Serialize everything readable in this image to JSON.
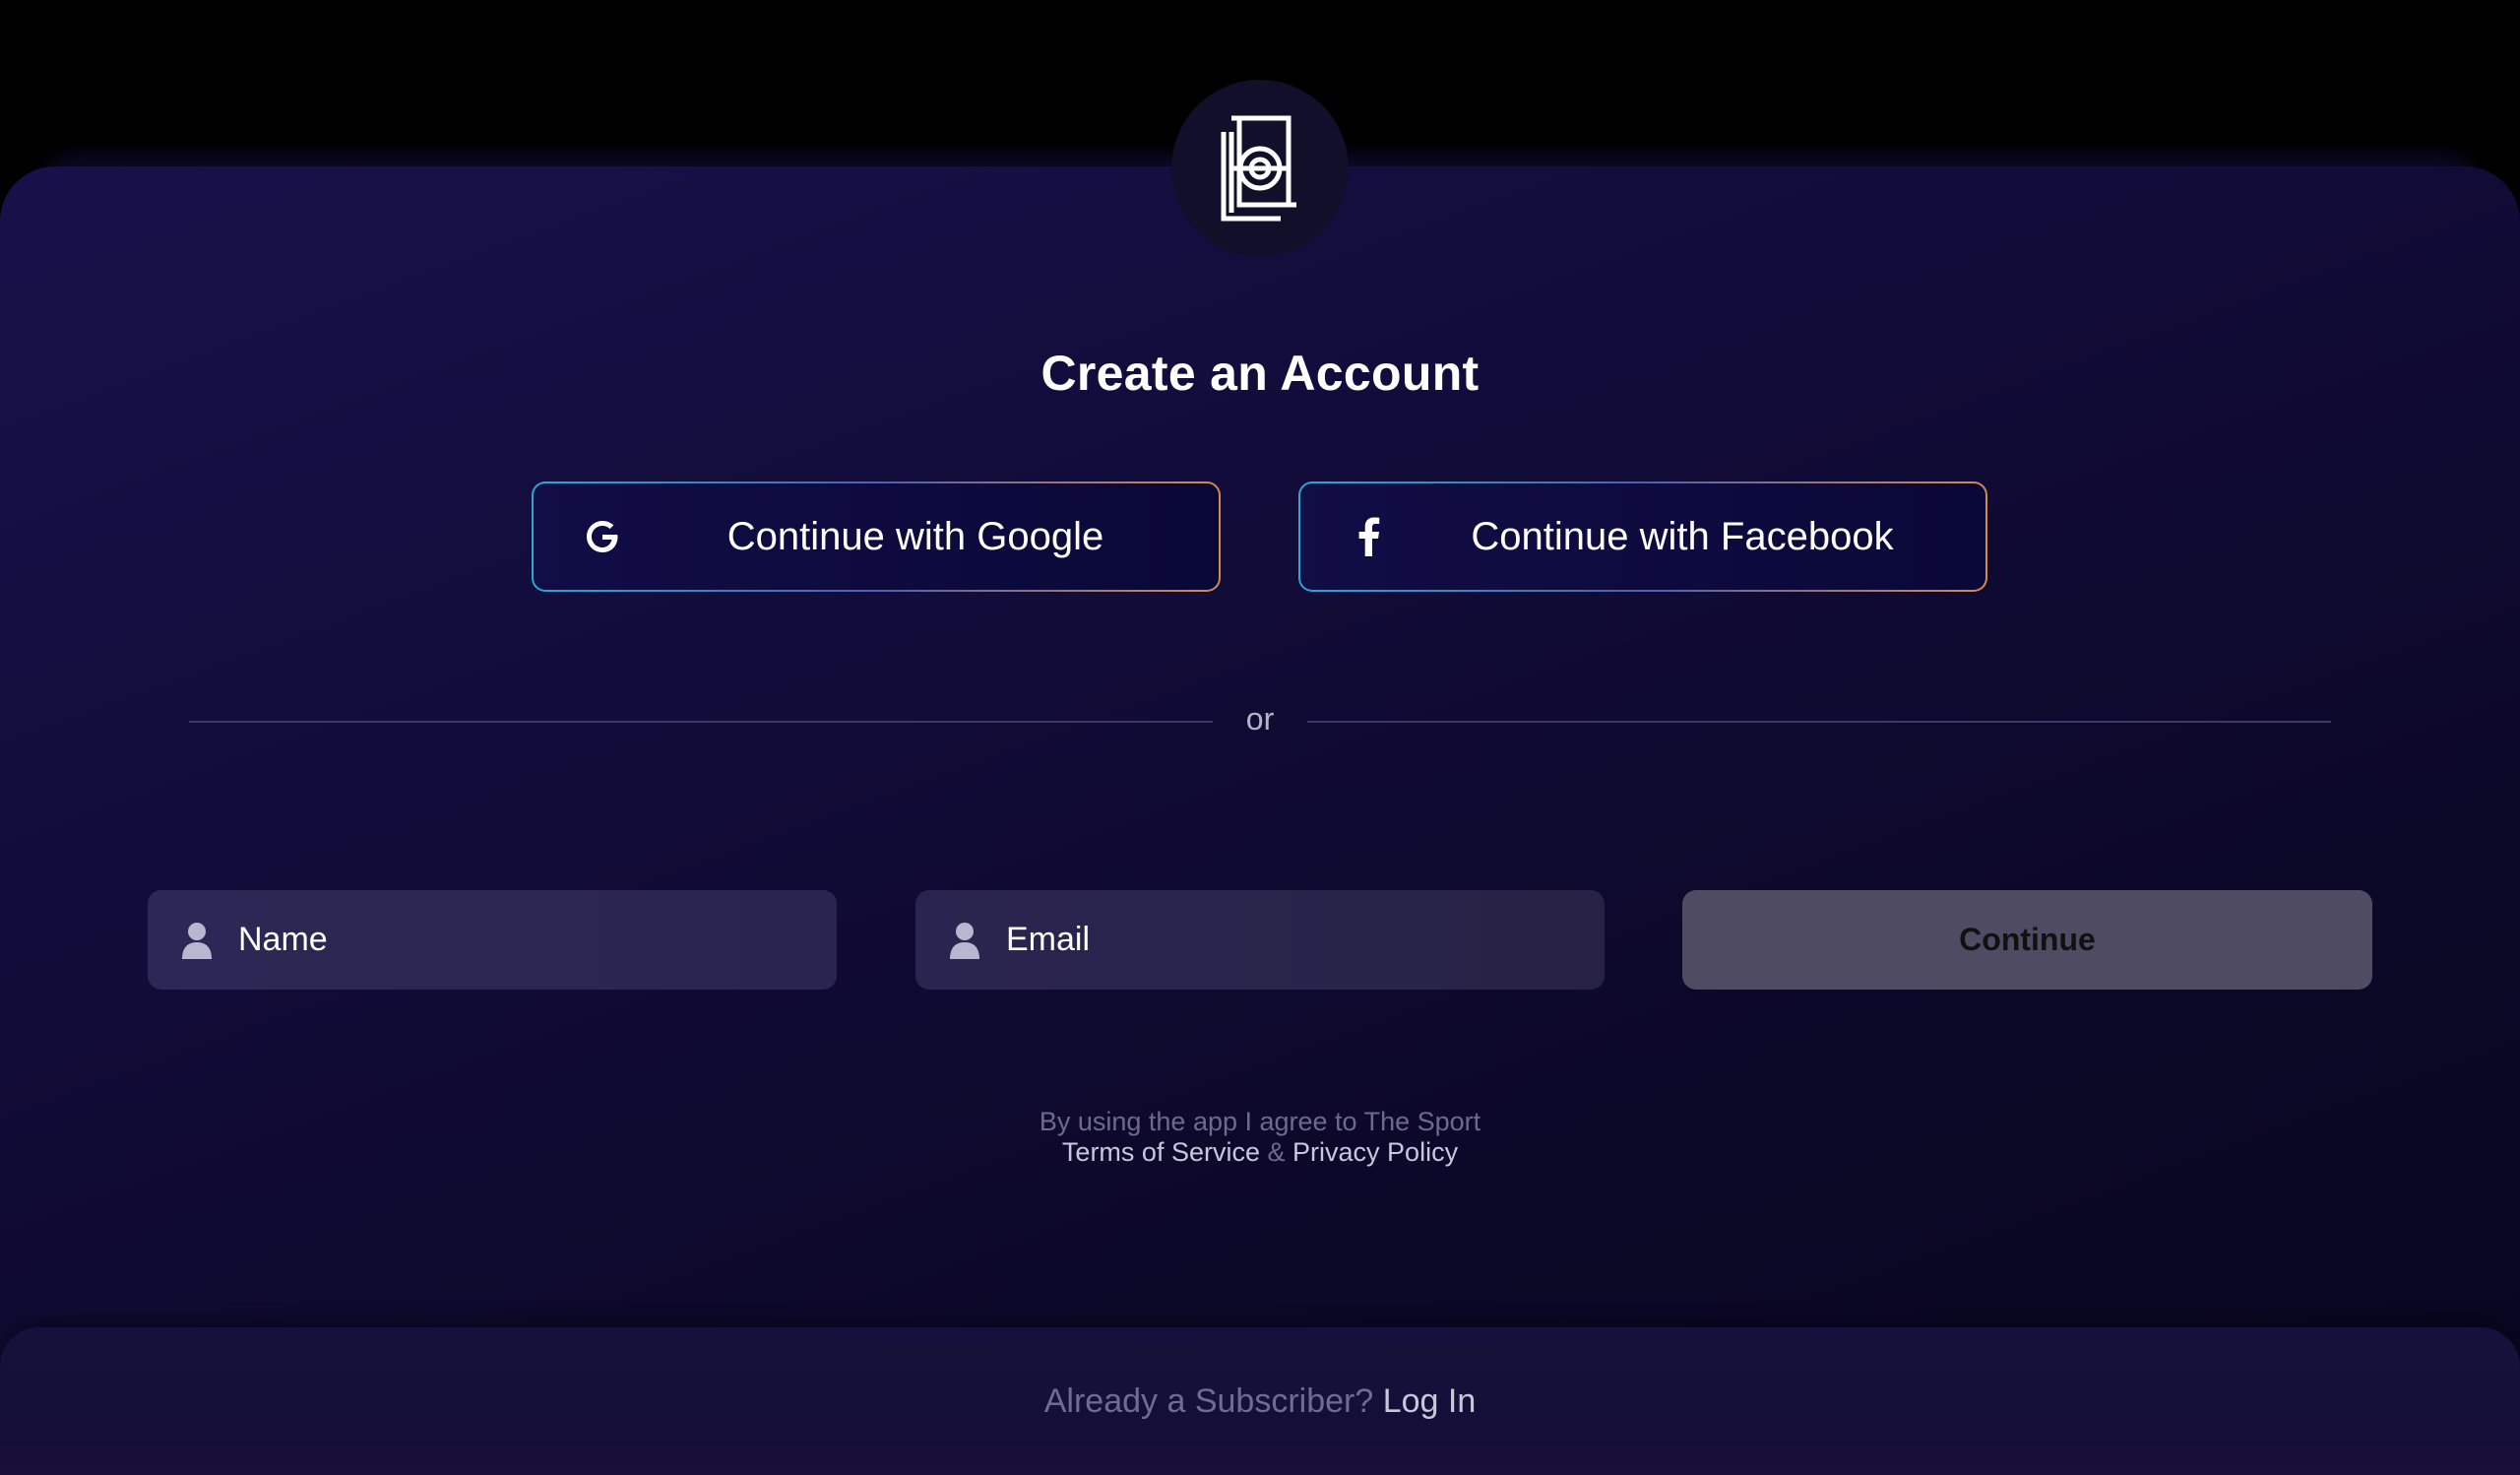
{
  "brand": {
    "logo_icon": "brand-logo-icon"
  },
  "page": {
    "title": "Create an Account"
  },
  "social": {
    "google": {
      "label": "Continue with Google",
      "icon": "google-icon"
    },
    "facebook": {
      "label": "Continue with Facebook",
      "icon": "facebook-icon"
    }
  },
  "divider": {
    "text": "or"
  },
  "form": {
    "name": {
      "placeholder": "Name",
      "icon": "person-icon"
    },
    "email": {
      "placeholder": "Email",
      "icon": "person-icon"
    },
    "continue_label": "Continue"
  },
  "legal": {
    "line1": "By using the app I agree to The Sport",
    "terms": "Terms of Service",
    "amp": "&",
    "privacy": "Privacy Policy"
  },
  "footer": {
    "prompt": "Already a Subscriber?",
    "login": "Log In"
  },
  "colors": {
    "background": "#000000",
    "card": "#130e3e",
    "field": "#2a2550",
    "continue_button": "#4e4b63",
    "accent_gradient_start": "#2aa7d4",
    "accent_gradient_end": "#d58a4a"
  }
}
